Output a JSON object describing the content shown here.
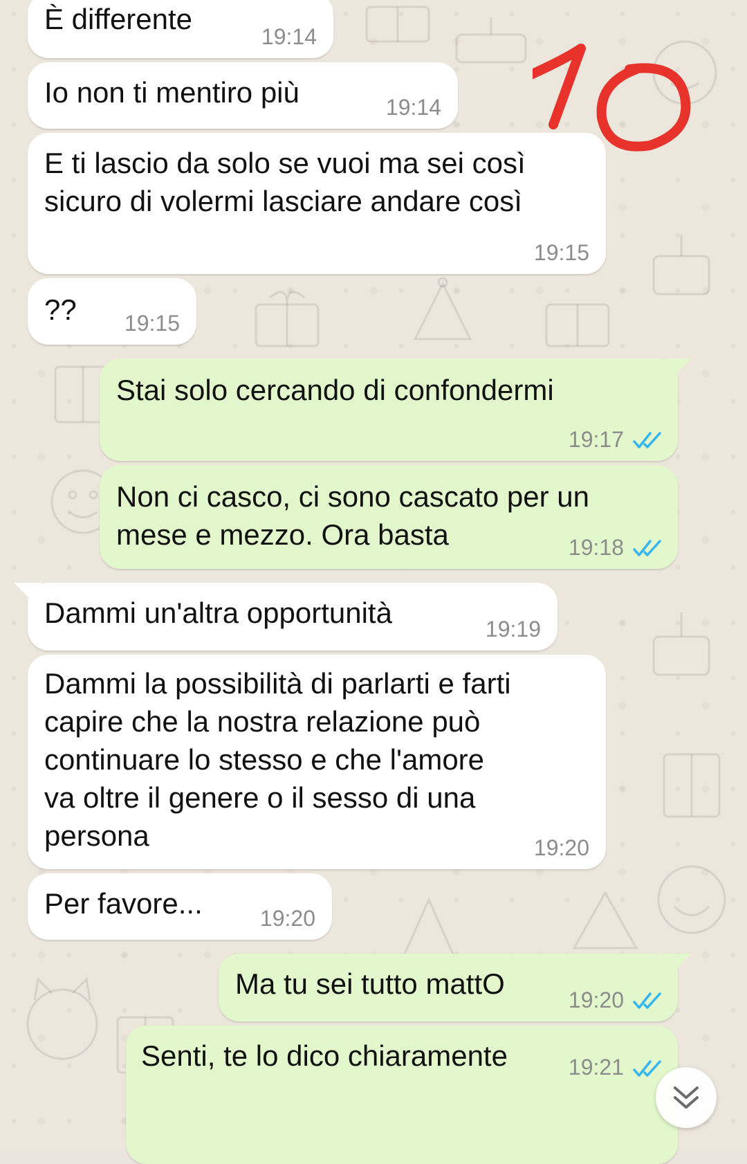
{
  "messages": [
    {
      "text": "È differente",
      "time": "19:14",
      "dir": "in"
    },
    {
      "text": "Io non ti mentiro più",
      "time": "19:14",
      "dir": "in"
    },
    {
      "text": "E ti lascio da solo se vuoi ma sei così\nsicuro di volermi lasciare andare così",
      "time": "19:15",
      "dir": "in"
    },
    {
      "text": "??",
      "time": "19:15",
      "dir": "in"
    },
    {
      "text": "Stai solo cercando di confondermi",
      "time": "19:17",
      "dir": "out",
      "status": "read"
    },
    {
      "text": "Non ci casco, ci sono cascato per un\nmese e mezzo. Ora basta",
      "time": "19:18",
      "dir": "out",
      "status": "read"
    },
    {
      "text": "Dammi un'altra opportunità",
      "time": "19:19",
      "dir": "in"
    },
    {
      "text": "Dammi la possibilità di parlarti e farti\ncapire che la nostra relazione può\ncontinuare lo stesso e che l'amore\nva oltre il genere o il sesso di una\npersona",
      "time": "19:20",
      "dir": "in"
    },
    {
      "text": "Per favore...",
      "time": "19:20",
      "dir": "in"
    },
    {
      "text": "Ma tu sei tutto mattO",
      "time": "19:20",
      "dir": "out",
      "status": "read"
    },
    {
      "text": "Senti, te lo dico chiaramente",
      "time": "19:21",
      "dir": "out",
      "status": "read"
    }
  ],
  "annotation": {
    "text": "10",
    "color": "#e8322c"
  },
  "icons": {
    "read_receipt": "double-check-icon",
    "scroll_down": "chevron-double-down-icon"
  },
  "colors": {
    "incoming": "#ffffff",
    "outgoing": "#e2f7cb",
    "tick": "#34b7f1",
    "time": "#8c8c8c"
  }
}
